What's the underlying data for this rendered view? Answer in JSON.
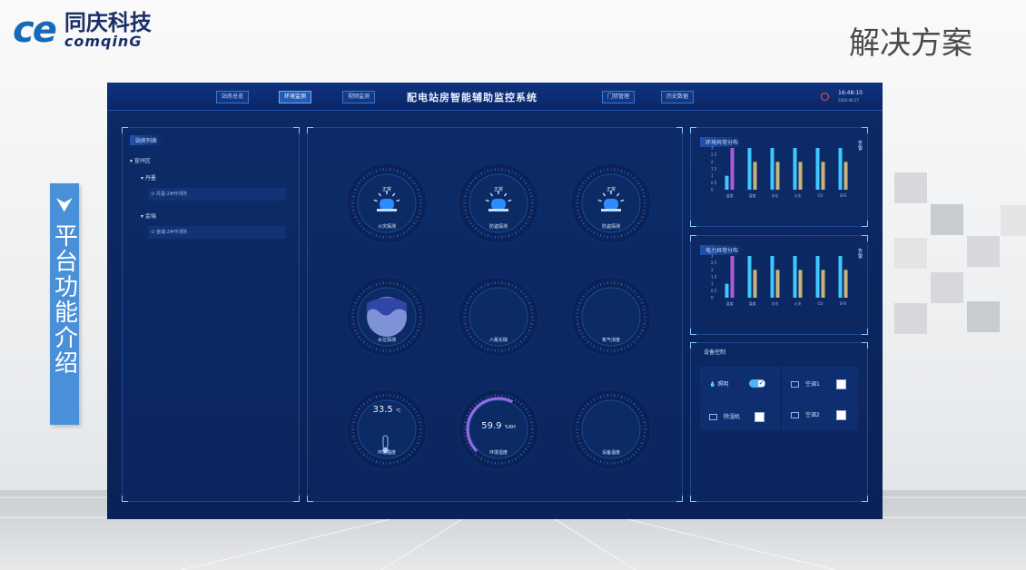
{
  "slide": {
    "logo_mark": "ce",
    "logo_cn": "同庆科技",
    "logo_en": "comqinG",
    "title": "解决方案",
    "side_arrow": "⮟",
    "side_label": "平台功能介绍"
  },
  "app": {
    "title": "配电站房智能辅助监控系统",
    "nav": [
      {
        "label": "站房总览",
        "active": false
      },
      {
        "label": "环境监测",
        "active": true
      },
      {
        "label": "视频监测",
        "active": false
      },
      {
        "label": "门禁管理",
        "active": false
      },
      {
        "label": "历史数据",
        "active": false
      }
    ],
    "clock_time": "16:48:10",
    "clock_date": "2020.09.27",
    "colors": {
      "background": "#0b2665",
      "accent": "#4fb3ff",
      "alarm": "#ff4d4d",
      "bar_cyan": "#3ec8ff",
      "bar_purple": "#b05bd6",
      "bar_gold": "#c9b37a"
    }
  },
  "station_list": {
    "title": "站房列表",
    "region": "宣州区",
    "groups": [
      {
        "name": "丹墨",
        "leaf": "丹墨-2#开闭所"
      },
      {
        "name": "金瑞",
        "leaf": "金瑞-2#开闭所"
      }
    ]
  },
  "monitor": {
    "gauges": [
      {
        "status": "正常",
        "label": "火灾探测",
        "icon": "alarm-siren-icon"
      },
      {
        "status": "正常",
        "label": "防盗探测",
        "icon": "alarm-siren-icon"
      },
      {
        "status": "正常",
        "label": "防盗探测",
        "icon": "alarm-siren-icon"
      },
      {
        "status": "",
        "label": "水位探测",
        "icon": "water-icon"
      },
      {
        "status": "",
        "label": "六氟化硫",
        "icon": ""
      },
      {
        "status": "",
        "label": "氧气浓度",
        "icon": ""
      },
      {
        "value": "33.5",
        "unit": "℃",
        "label": "环境温度",
        "icon": "thermometer-icon"
      },
      {
        "value": "59.9",
        "unit": "%RH",
        "label": "环境湿度",
        "icon": "",
        "level": 0.6
      },
      {
        "status": "",
        "label": "设备温度",
        "icon": ""
      }
    ]
  },
  "env_chart": {
    "title": "环境异常分布",
    "alarm_tag": "告警",
    "chart_data": {
      "type": "bar",
      "categories": [
        "温度",
        "湿度",
        "水位",
        "火灾",
        "CO",
        "SF6"
      ],
      "series": [
        {
          "values": [
            1,
            3,
            3,
            3,
            3,
            3
          ]
        },
        {
          "values": [
            3,
            2,
            2,
            2,
            2,
            2
          ]
        }
      ],
      "ylim": [
        0,
        3
      ],
      "yticks": [
        "0",
        "0.5",
        "1",
        "1.5",
        "2",
        "2.5",
        "3"
      ]
    }
  },
  "power_chart": {
    "title": "电力异常分布",
    "alarm_tag": "告警",
    "chart_data": {
      "type": "bar",
      "categories": [
        "温度",
        "湿度",
        "水位",
        "火灾",
        "CO",
        "SF6"
      ],
      "series": [
        {
          "values": [
            1,
            3,
            3,
            3,
            3,
            3
          ]
        },
        {
          "values": [
            3,
            2,
            2,
            2,
            2,
            2
          ]
        }
      ],
      "ylim": [
        0,
        3
      ],
      "yticks": [
        "0",
        "0.5",
        "1",
        "1.5",
        "2",
        "2.5",
        "3"
      ]
    }
  },
  "device_control": {
    "title": "设备控制",
    "items": [
      {
        "label": "照明",
        "on": true
      },
      {
        "label": "空调1",
        "on": false
      },
      {
        "label": "除湿机",
        "on": false
      },
      {
        "label": "空调2",
        "on": false
      }
    ]
  }
}
